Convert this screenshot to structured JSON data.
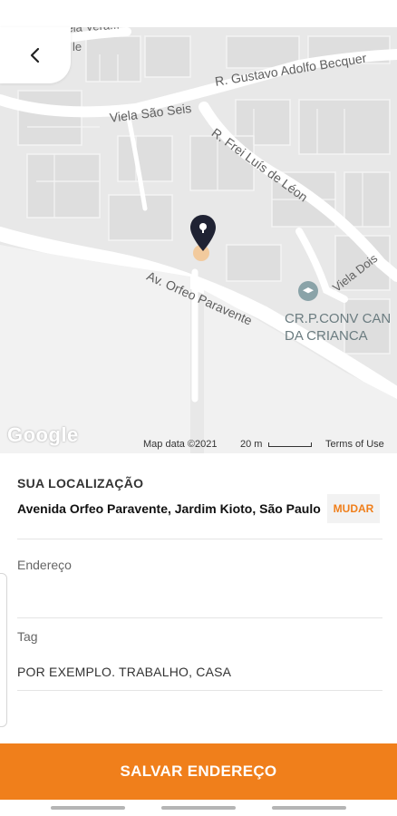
{
  "map": {
    "streets": [
      "R. Gustavo Adolfo Becquer",
      "Viela São Seis",
      "R. Frei Luís de Léon",
      "Av. Orfeo Paravente",
      "Viela Dois"
    ],
    "poi": [
      "CR.P.CONV CAN",
      "DA CRIANCA"
    ],
    "partial_labels": [
      "Viela Vera...",
      "le"
    ],
    "attribution": {
      "google": "Google",
      "map_data": "Map data ©2021",
      "scale": "20 m",
      "terms": "Terms of Use"
    }
  },
  "location": {
    "section_title": "SUA LOCALIZAÇÃO",
    "address": "Avenida Orfeo Paravente, Jardim Kioto, São Paulo",
    "change_label": "MUDAR"
  },
  "form": {
    "address_label": "Endereço",
    "address_value": "",
    "tag_label": "Tag",
    "tag_placeholder": "POR EXEMPLO. TRABALHO, CASA"
  },
  "save_label": "SALVAR ENDEREÇO",
  "colors": {
    "accent": "#f07f1b",
    "pin": "#1f2233",
    "map_bg": "#e8e8e8"
  },
  "icons": {
    "back": "chevron-left-icon",
    "pin": "location-pin-icon",
    "poi": "school-icon"
  }
}
